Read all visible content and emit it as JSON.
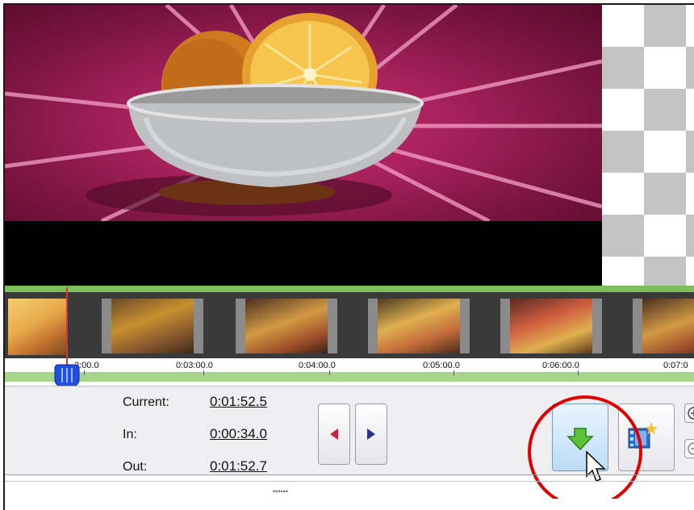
{
  "timeline": {
    "ruler_labels": [
      "2:00.0",
      "0:03:00.0",
      "0:04:00.0",
      "0:05:00.0",
      "0:06:00.0",
      "0:07:0"
    ]
  },
  "position": {
    "current_label": "Current:",
    "current_value": "0:01:52.5",
    "in_label": "In:",
    "in_value": "0:00:34.0",
    "out_label": "Out:",
    "out_value": "0:01:52.7"
  },
  "grip": "••••••",
  "icons": [
    "mark-in-left-icon",
    "mark-out-right-icon",
    "insert-down-arrow-icon",
    "new-clip-icon",
    "zoom-in-icon",
    "zoom-out-icon",
    "mouse-cursor-icon"
  ],
  "colors": {
    "highlight_circle": "#e00000",
    "accent_green": "#5cb83a",
    "timeline_green": "#7fbf5a"
  }
}
